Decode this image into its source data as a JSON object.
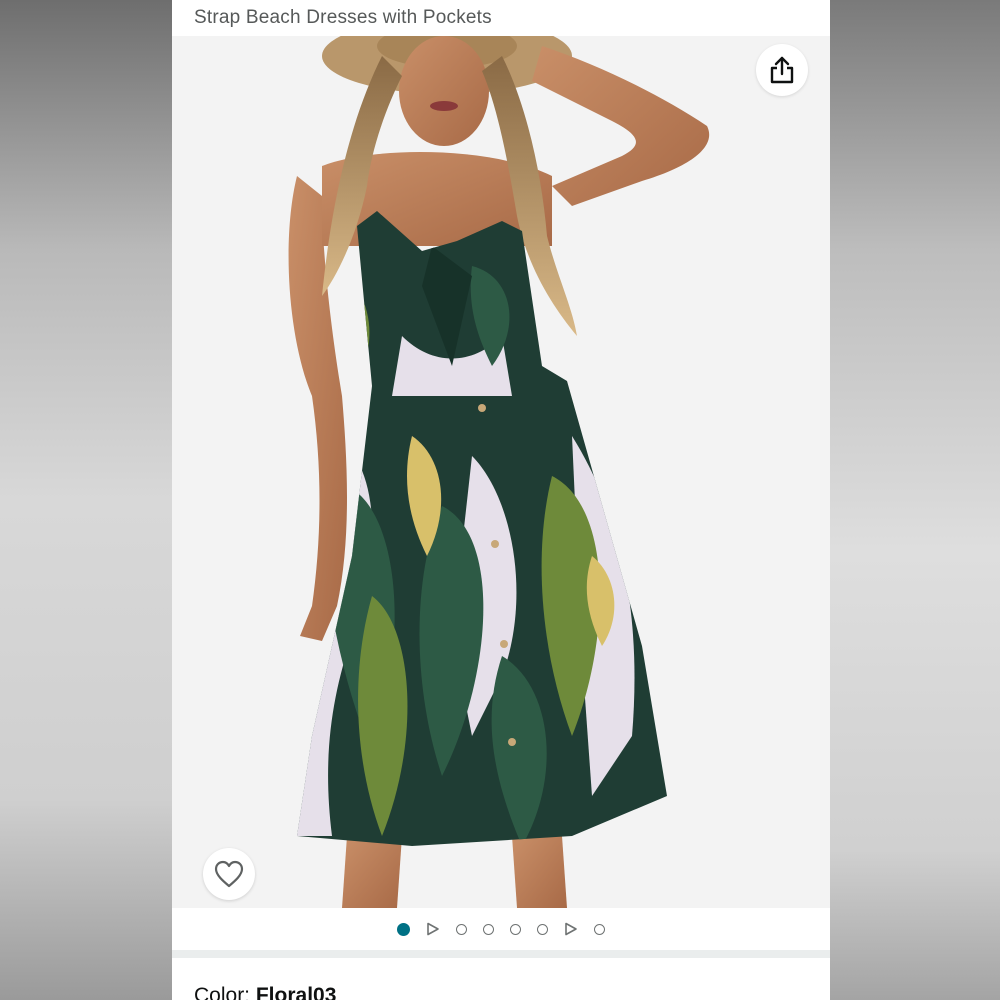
{
  "header": {
    "title": "Strap Beach Dresses with Pockets"
  },
  "image": {
    "share_icon": "share-icon",
    "wishlist_icon": "heart-icon",
    "background": "#f3f3f3",
    "dress_colors": [
      "#1f3d34",
      "#2d5a45",
      "#6e8a3a",
      "#e6e0ea",
      "#d8c06a"
    ]
  },
  "carousel": {
    "items": [
      {
        "kind": "image",
        "active": true
      },
      {
        "kind": "video",
        "active": false
      },
      {
        "kind": "image",
        "active": false
      },
      {
        "kind": "image",
        "active": false
      },
      {
        "kind": "image",
        "active": false
      },
      {
        "kind": "image",
        "active": false
      },
      {
        "kind": "video",
        "active": false
      },
      {
        "kind": "image",
        "active": false
      }
    ],
    "active_color": "#007185"
  },
  "variant": {
    "label": "Color: ",
    "value": "Floral03"
  }
}
